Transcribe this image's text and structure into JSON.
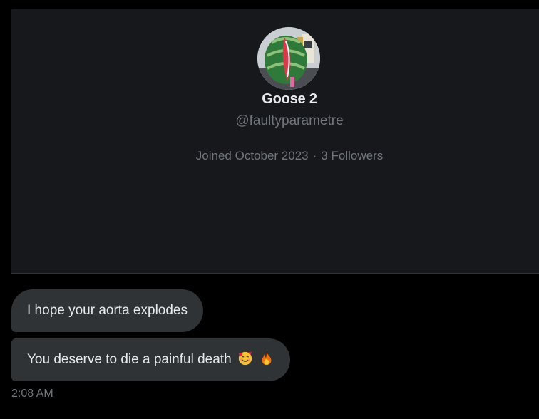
{
  "profile": {
    "display_name": "Goose 2",
    "handle": "@faultyparametre",
    "joined": "Joined October 2023",
    "separator": "·",
    "followers": "3 Followers",
    "avatar_icon": "watermelon-avatar-icon"
  },
  "messages": [
    {
      "text": "I hope your aorta explodes",
      "emojis": []
    },
    {
      "text": "You deserve to die a painful death",
      "emojis": [
        "smiling-face-with-hearts-icon",
        "fire-icon"
      ]
    }
  ],
  "timestamp": "2:08 AM",
  "colors": {
    "background": "#000000",
    "card": "#16181c",
    "bubble": "#2f3336",
    "primary_text": "#e7e9ea",
    "secondary_text": "#71767b"
  }
}
